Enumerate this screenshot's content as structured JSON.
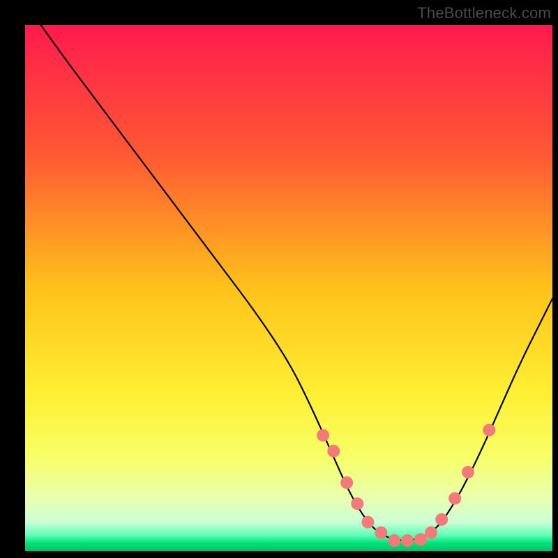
{
  "watermark": "TheBottleneck.com",
  "chart_data": {
    "type": "line",
    "title": "",
    "xlabel": "",
    "ylabel": "",
    "xlim": [
      0,
      100
    ],
    "ylim": [
      0,
      100
    ],
    "grid": false,
    "legend": null,
    "background_gradient": {
      "stops": [
        {
          "offset": 0.0,
          "color": "#ff1a4d"
        },
        {
          "offset": 0.25,
          "color": "#ff5a33"
        },
        {
          "offset": 0.5,
          "color": "#ffc21a"
        },
        {
          "offset": 0.7,
          "color": "#ffef33"
        },
        {
          "offset": 0.82,
          "color": "#f7ff66"
        },
        {
          "offset": 0.9,
          "color": "#e8ffb0"
        },
        {
          "offset": 0.945,
          "color": "#caffd6"
        },
        {
          "offset": 0.97,
          "color": "#5fffb4"
        },
        {
          "offset": 0.985,
          "color": "#00e27a"
        },
        {
          "offset": 1.0,
          "color": "#00c26a"
        }
      ]
    },
    "series": [
      {
        "name": "bottleneck-curve",
        "type": "line",
        "color": "#000000",
        "x": [
          3,
          8,
          14,
          20,
          26,
          32,
          38,
          44,
          50,
          54,
          58,
          62,
          66,
          70,
          74,
          78,
          82,
          86,
          90,
          94,
          98,
          100
        ],
        "y": [
          100,
          93,
          85,
          77,
          69,
          61,
          53,
          45,
          36,
          28,
          19,
          10,
          4,
          2,
          2,
          4,
          10,
          18,
          27,
          36,
          44,
          48
        ]
      },
      {
        "name": "threshold-markers",
        "type": "scatter",
        "color": "#f47a7a",
        "marker_radius": 9,
        "x": [
          56.5,
          58.5,
          61,
          63,
          65,
          67.5,
          70,
          72.5,
          75,
          77,
          79,
          81.5,
          84,
          88
        ],
        "y": [
          22,
          19,
          13,
          9,
          5.5,
          3.5,
          2,
          2,
          2.2,
          3.5,
          6,
          10,
          15,
          23
        ]
      }
    ],
    "annotations": []
  }
}
